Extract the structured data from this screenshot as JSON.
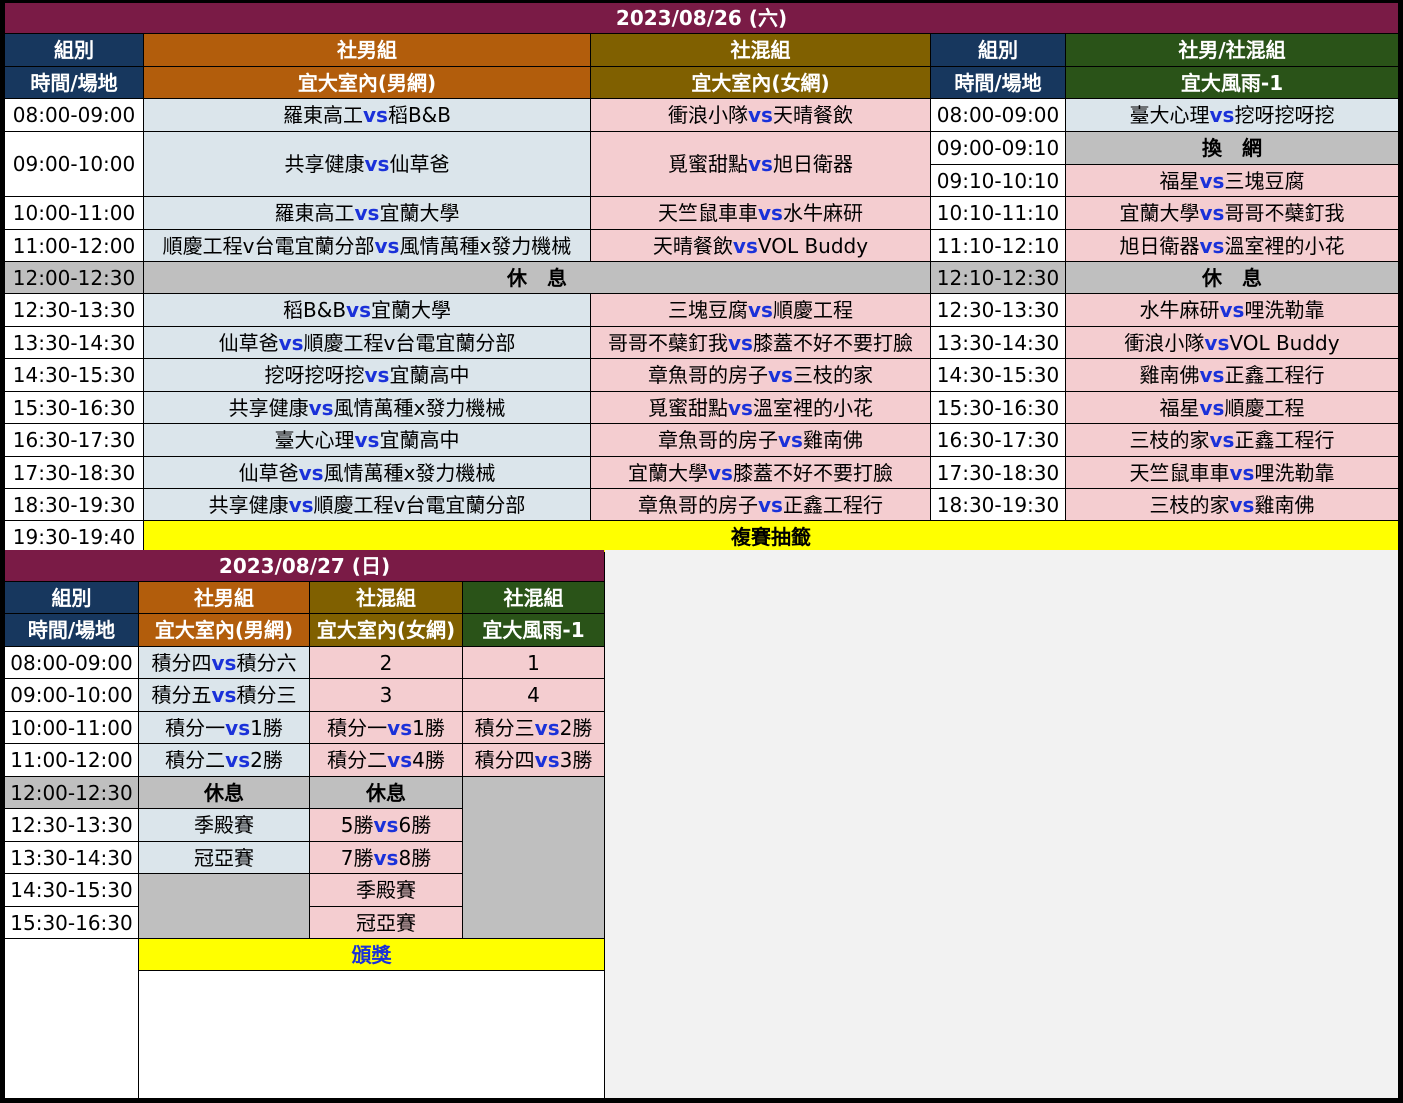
{
  "colors": {
    "day_header": "#7a1b46",
    "group_blue": "#17375e",
    "men_orange": "#b25d0c",
    "mixed_olive": "#806000",
    "mixed_green": "#2a5318",
    "cell_lightblue": "#dbe5eb",
    "cell_pink": "#f4cdd0",
    "cell_gray": "#bfbfbf",
    "highlight_yellow": "#ffff00",
    "vs_blue": "#1a31d9"
  },
  "day1": {
    "date": "2023/08/26 (六)",
    "header": {
      "group_label": "組別",
      "timevenue_label": "時間/場地",
      "men_group": "社男組",
      "men_venue": "宜大室內(男網)",
      "mixed_group": "社混組",
      "mixed_venue": "宜大室內(女網)",
      "group_label2": "組別",
      "timevenue_label2": "時間/場地",
      "rain_group": "社男/社混組",
      "rain_venue": "宜大風雨-1"
    },
    "rows": [
      {
        "time": "08:00-09:00",
        "men": [
          "羅東高工",
          "稻B&B"
        ],
        "mixed": [
          "衝浪小隊",
          "天晴餐飲"
        ]
      },
      {
        "time": "09:00-10:00",
        "men": [
          "共享健康",
          "仙草爸"
        ],
        "mixed": [
          "覓蜜甜點",
          "旭日衛器"
        ]
      },
      {
        "time": "10:00-11:00",
        "men": [
          "羅東高工",
          "宜蘭大學"
        ],
        "mixed": [
          "天竺鼠車車",
          "水牛麻研"
        ]
      },
      {
        "time": "11:00-12:00",
        "men": [
          "順慶工程v台電宜蘭分部",
          "風情萬種x發力機械"
        ],
        "mixed": [
          "天晴餐飲",
          "VOL Buddy"
        ]
      },
      {
        "time": "12:00-12:30",
        "rest": "休　息"
      },
      {
        "time": "12:30-13:30",
        "men": [
          "稻B&B",
          "宜蘭大學"
        ],
        "mixed": [
          "三塊豆腐",
          "順慶工程"
        ]
      },
      {
        "time": "13:30-14:30",
        "men": [
          "仙草爸",
          "順慶工程v台電宜蘭分部"
        ],
        "mixed": [
          "哥哥不蘗釘我",
          "膝蓋不好不要打臉"
        ]
      },
      {
        "time": "14:30-15:30",
        "men": [
          "挖呀挖呀挖",
          "宜蘭高中"
        ],
        "mixed": [
          "章魚哥的房子",
          "三枝的家"
        ]
      },
      {
        "time": "15:30-16:30",
        "men": [
          "共享健康",
          "風情萬種x發力機械"
        ],
        "mixed": [
          "覓蜜甜點",
          "溫室裡的小花"
        ]
      },
      {
        "time": "16:30-17:30",
        "men": [
          "臺大心理",
          "宜蘭高中"
        ],
        "mixed": [
          "章魚哥的房子",
          "雞南佛"
        ]
      },
      {
        "time": "17:30-18:30",
        "men": [
          "仙草爸",
          "風情萬種x發力機械"
        ],
        "mixed": [
          "宜蘭大學",
          "膝蓋不好不要打臉"
        ]
      },
      {
        "time": "18:30-19:30",
        "men": [
          "共享健康",
          "順慶工程v台電宜蘭分部"
        ],
        "mixed": [
          "章魚哥的房子",
          "正鑫工程行"
        ]
      },
      {
        "time": "19:30-19:40",
        "draw": "複賽抽籤"
      }
    ],
    "rain_rows": [
      {
        "time": "08:00-09:00",
        "match": [
          "臺大心理",
          "挖呀挖呀挖"
        ]
      },
      {
        "time": "09:00-09:10",
        "label": "換　網"
      },
      {
        "time": "09:10-10:10",
        "match": [
          "福星",
          "三塊豆腐"
        ]
      },
      {
        "time": "10:10-11:10",
        "match": [
          "宜蘭大學",
          "哥哥不蘗釘我"
        ]
      },
      {
        "time": "11:10-12:10",
        "match": [
          "旭日衛器",
          "溫室裡的小花"
        ]
      },
      {
        "time": "12:10-12:30",
        "label": "休　息"
      },
      {
        "time": "12:30-13:30",
        "match": [
          "水牛麻研",
          "哩洗勒靠"
        ]
      },
      {
        "time": "13:30-14:30",
        "match": [
          "衝浪小隊",
          "VOL Buddy"
        ]
      },
      {
        "time": "14:30-15:30",
        "match": [
          "雞南佛",
          "正鑫工程行"
        ]
      },
      {
        "time": "15:30-16:30",
        "match": [
          "福星",
          "順慶工程"
        ]
      },
      {
        "time": "16:30-17:30",
        "match": [
          "三枝的家",
          "正鑫工程行"
        ]
      },
      {
        "time": "17:30-18:30",
        "match": [
          "天竺鼠車車",
          "哩洗勒靠"
        ]
      },
      {
        "time": "18:30-19:30",
        "match": [
          "三枝的家",
          "雞南佛"
        ]
      }
    ]
  },
  "day2": {
    "date": "2023/08/27 (日)",
    "header": {
      "group_label": "組別",
      "timevenue_label": "時間/場地",
      "men_group": "社男組",
      "men_venue": "宜大室內(男網)",
      "mixed_group": "社混組",
      "mixed_venue": "宜大室內(女網)",
      "mixed2_group": "社混組",
      "mixed2_venue": "宜大風雨-1"
    },
    "times": [
      "08:00-09:00",
      "09:00-10:00",
      "10:00-11:00",
      "11:00-12:00",
      "12:00-12:30",
      "12:30-13:30",
      "13:30-14:30",
      "14:30-15:30",
      "15:30-16:30"
    ],
    "men": [
      {
        "a": "積分四",
        "b": "積分六"
      },
      {
        "a": "積分五",
        "b": "積分三"
      },
      {
        "a": "積分一",
        "b": "1勝"
      },
      {
        "a": "積分二",
        "b": "2勝"
      },
      {
        "text": "休息"
      },
      {
        "text": "季殿賽"
      },
      {
        "text": "冠亞賽"
      }
    ],
    "mixed": [
      {
        "text": "2"
      },
      {
        "text": "3"
      },
      {
        "a": "積分一",
        "b": "1勝"
      },
      {
        "a": "積分二",
        "b": "4勝"
      },
      {
        "text": "休息"
      },
      {
        "a": "5勝",
        "b": "6勝"
      },
      {
        "a": "7勝",
        "b": "8勝"
      },
      {
        "text": "季殿賽"
      },
      {
        "text": "冠亞賽"
      }
    ],
    "mixed2": [
      {
        "text": "1"
      },
      {
        "text": "4"
      },
      {
        "a": "積分三",
        "b": "2勝"
      },
      {
        "a": "積分四",
        "b": "3勝"
      }
    ],
    "vs": "vs",
    "award": "頒獎"
  }
}
